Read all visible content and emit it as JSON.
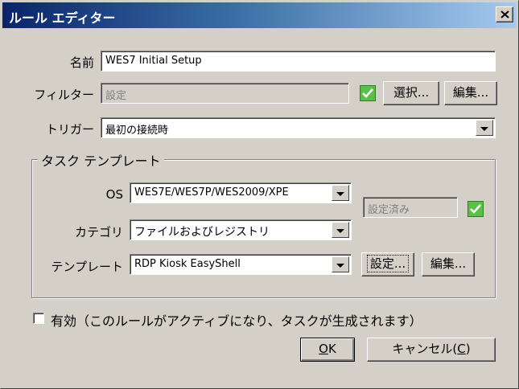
{
  "window": {
    "title": "ルール エディター",
    "close_label": "×"
  },
  "form": {
    "name": {
      "label": "名前",
      "value": "WES7 Initial Setup"
    },
    "filter": {
      "label": "フィルター",
      "value": "設定",
      "checked": true,
      "select_label": "選択...",
      "edit_label": "編集..."
    },
    "trigger": {
      "label": "トリガー",
      "value": "最初の接続時"
    }
  },
  "task_template": {
    "legend": "タスク テンプレート",
    "os": {
      "label": "OS",
      "value": "WES7E/WES7P/WES2009/XPE"
    },
    "category": {
      "label": "カテゴリ",
      "value": "ファイルおよびレジストリ"
    },
    "template": {
      "label": "テンプレート",
      "value": "RDP Kiosk EasyShell",
      "settings_label": "設定...",
      "edit_label": "編集..."
    },
    "status": {
      "value": "設定済み",
      "checked": true
    }
  },
  "enable": {
    "checked": false,
    "label": "有効（このルールがアクティブになり、タスクが生成されます）"
  },
  "buttons": {
    "ok_mnemonic": "O",
    "ok_rest": "K",
    "cancel_prefix": "キャンセル(",
    "cancel_mnemonic": "C",
    "cancel_suffix": ")"
  },
  "colors": {
    "titlebar_start": "#0a246a",
    "titlebar_end": "#a6caf0",
    "dialog_bg": "#d4d0c8",
    "check_green": "#5ac04a"
  }
}
